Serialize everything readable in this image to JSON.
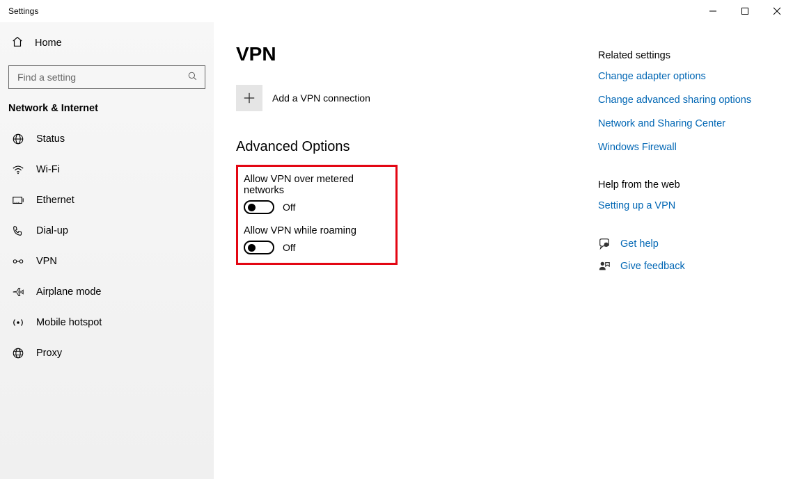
{
  "window": {
    "title": "Settings"
  },
  "sidebar": {
    "home": "Home",
    "search_placeholder": "Find a setting",
    "category": "Network & Internet",
    "items": [
      {
        "label": "Status"
      },
      {
        "label": "Wi-Fi"
      },
      {
        "label": "Ethernet"
      },
      {
        "label": "Dial-up"
      },
      {
        "label": "VPN"
      },
      {
        "label": "Airplane mode"
      },
      {
        "label": "Mobile hotspot"
      },
      {
        "label": "Proxy"
      }
    ]
  },
  "main": {
    "title": "VPN",
    "add_label": "Add a VPN connection",
    "advanced_heading": "Advanced Options",
    "opt1_label": "Allow VPN over metered networks",
    "opt1_state": "Off",
    "opt2_label": "Allow VPN while roaming",
    "opt2_state": "Off"
  },
  "right": {
    "related_heading": "Related settings",
    "link1": "Change adapter options",
    "link2": "Change advanced sharing options",
    "link3": "Network and Sharing Center",
    "link4": "Windows Firewall",
    "help_heading": "Help from the web",
    "link5": "Setting up a VPN",
    "get_help": "Get help",
    "give_feedback": "Give feedback"
  }
}
